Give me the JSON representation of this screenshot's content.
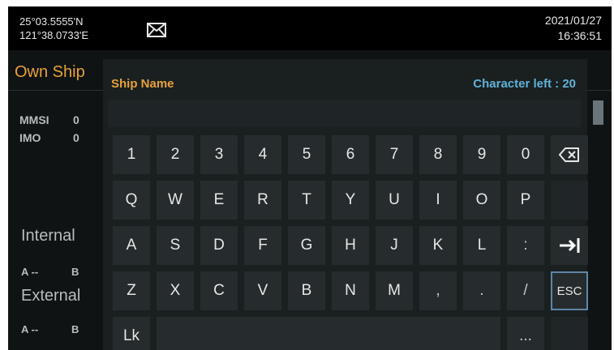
{
  "status_bar": {
    "latitude": "25°03.5555'N",
    "longitude": "121°38.0733'E",
    "date": "2021/01/27",
    "time": "16:36:51",
    "mail_icon": "envelope-icon"
  },
  "background_page": {
    "title": "Own Ship",
    "fields": [
      {
        "label": "MMSI",
        "value": "0"
      },
      {
        "label": "IMO",
        "value": "0"
      }
    ],
    "section_internal": "Internal",
    "internal_row": {
      "a": "A --",
      "b": "B"
    },
    "section_external": "External",
    "external_row": {
      "a": "A --",
      "b": "B"
    }
  },
  "keyboard": {
    "field_label": "Ship Name",
    "chars_left": "Character left : 20",
    "input_value": "",
    "row1": [
      "1",
      "2",
      "3",
      "4",
      "5",
      "6",
      "7",
      "8",
      "9",
      "0"
    ],
    "row2": [
      "Q",
      "W",
      "E",
      "R",
      "T",
      "Y",
      "U",
      "I",
      "O",
      "P"
    ],
    "row3": [
      "A",
      "S",
      "D",
      "F",
      "G",
      "H",
      "J",
      "K",
      "L",
      ":"
    ],
    "row4": [
      "Z",
      "X",
      "C",
      "V",
      "B",
      "N",
      "M",
      ",",
      ".",
      "/"
    ],
    "esc_label": "ESC",
    "lk_label": "Lk",
    "more_label": "...",
    "backspace_icon": "backspace-icon",
    "tab_icon": "tab-arrow-icon"
  },
  "colors": {
    "accent_orange": "#e8a13a",
    "accent_blue": "#5fb2d8",
    "background": "#0f1314",
    "key": "#262c2d",
    "esc_border": "#5e86a8"
  }
}
